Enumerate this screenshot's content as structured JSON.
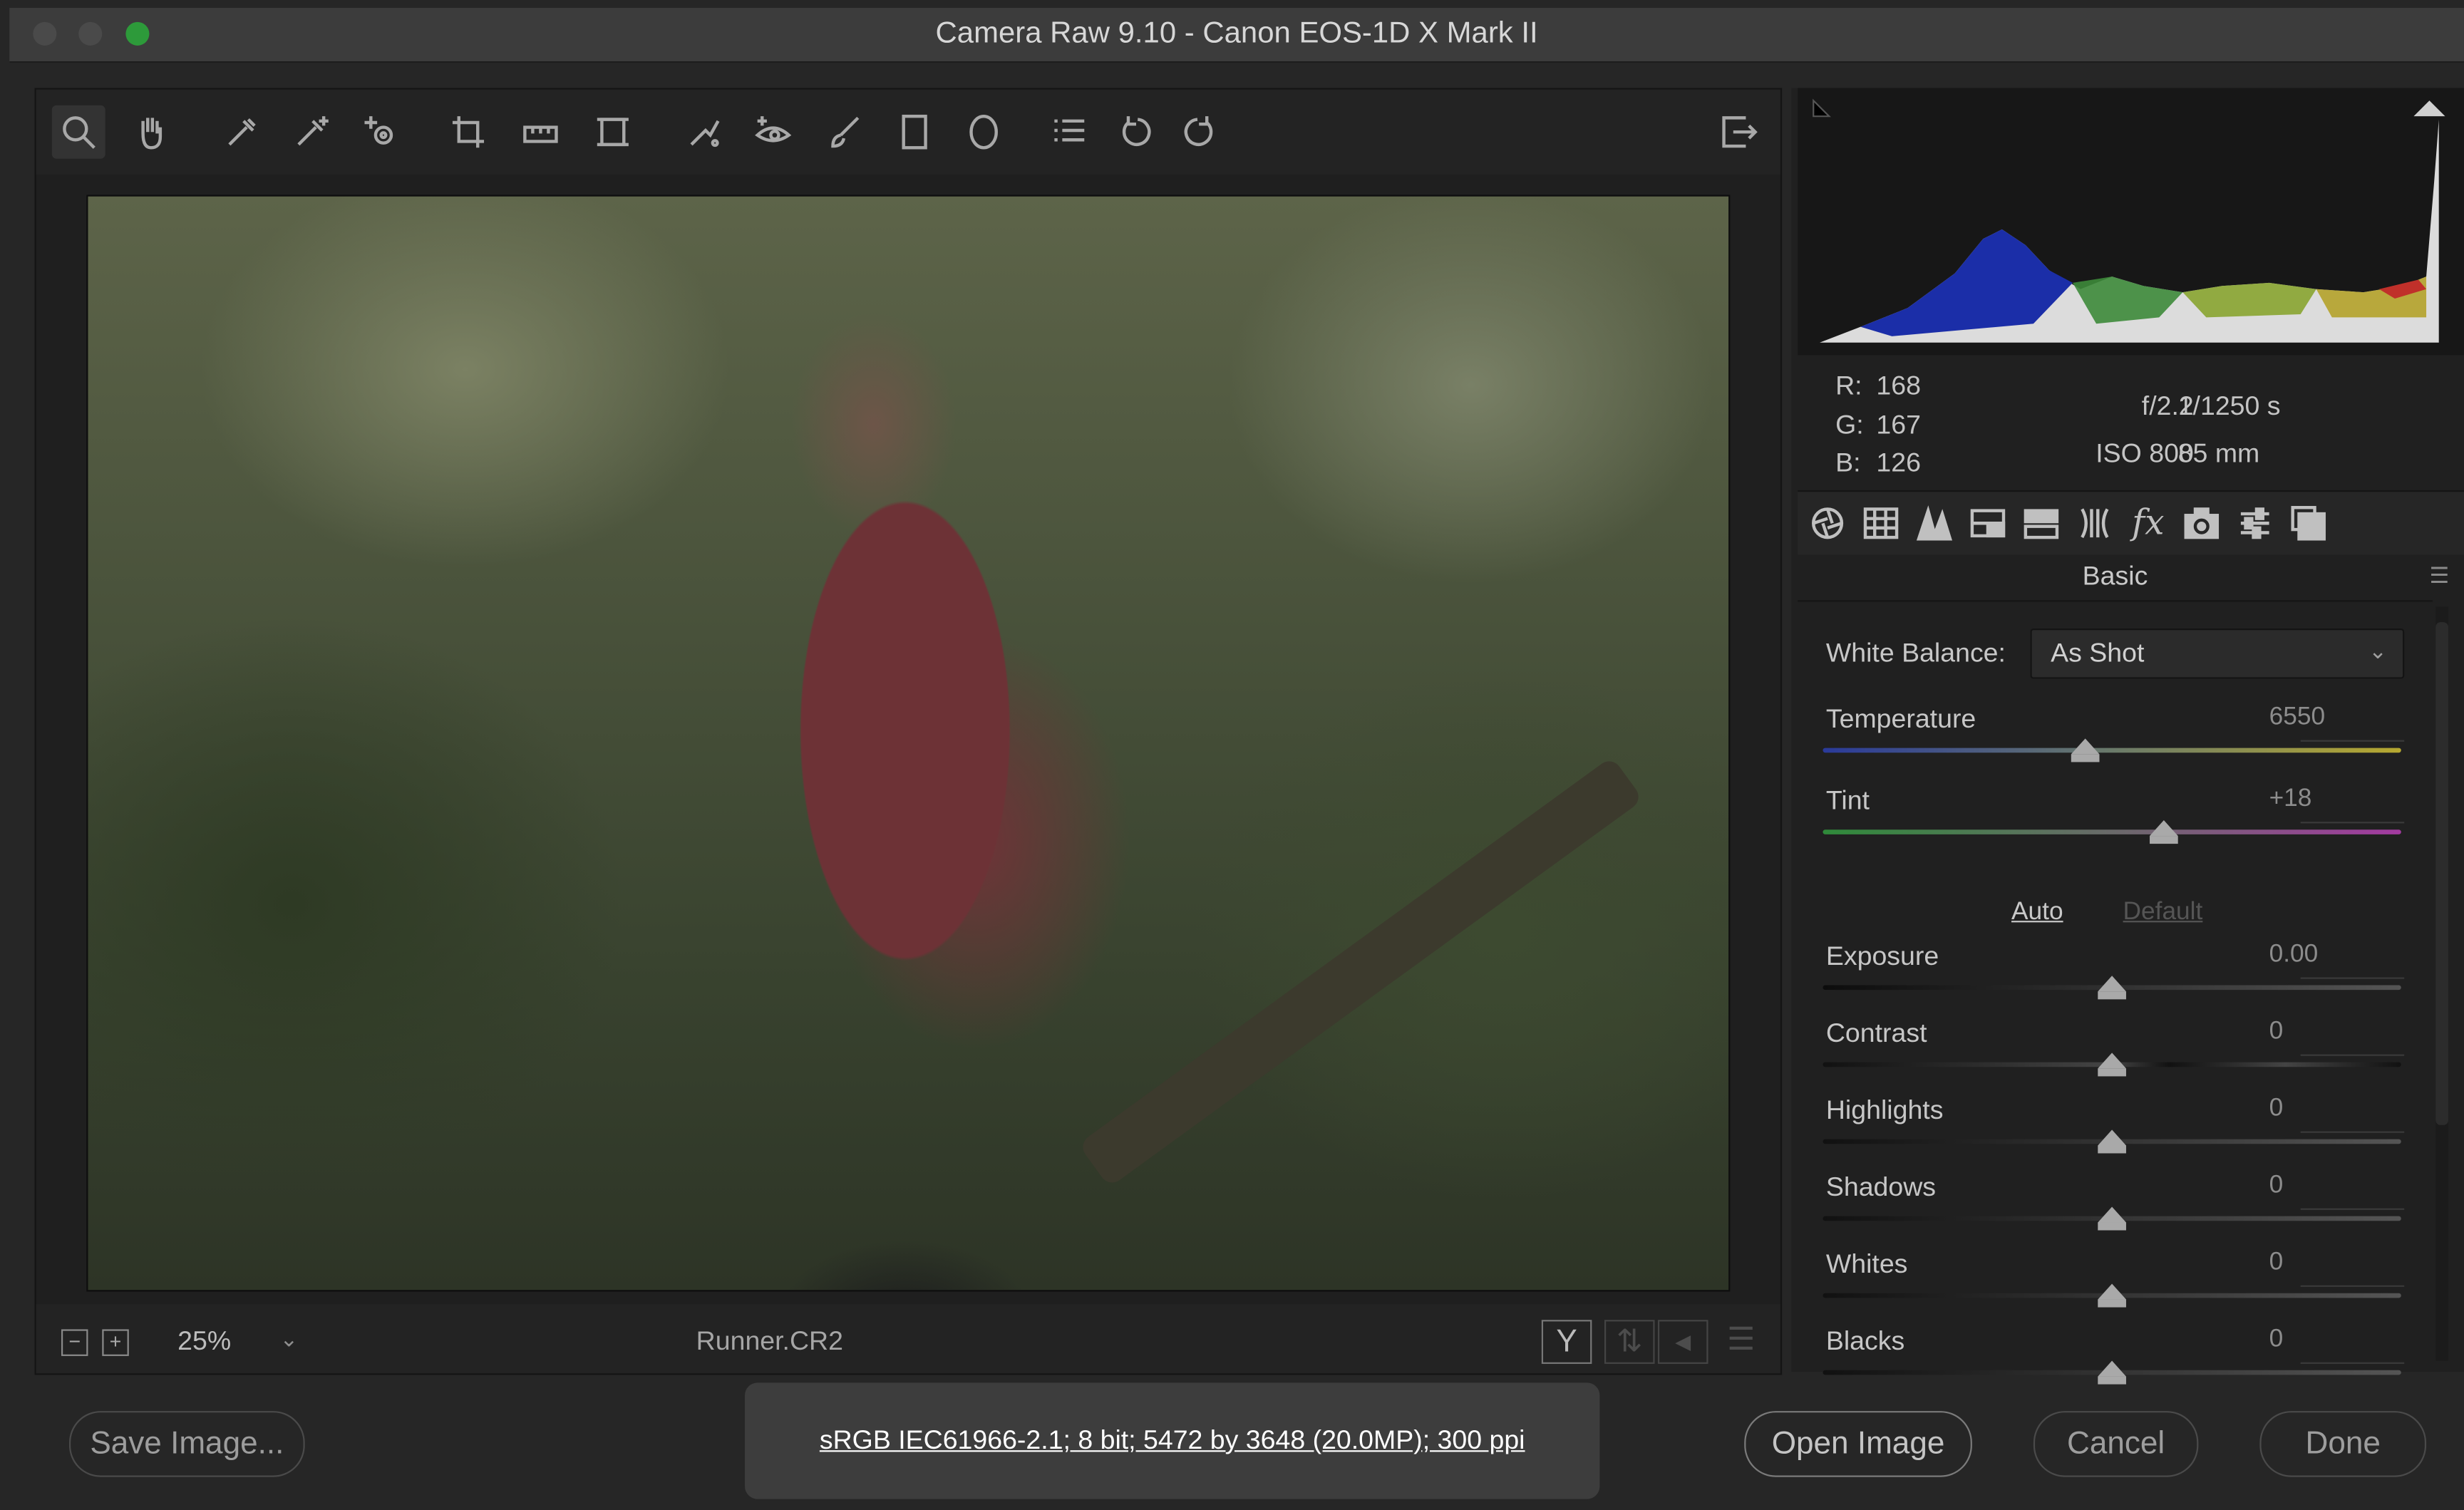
{
  "window": {
    "title": "Camera Raw 9.10  -  Canon EOS-1D X Mark II"
  },
  "toolbar": {
    "tools": [
      "zoom-icon",
      "hand-icon",
      "eyedropper-icon",
      "color-sampler-icon",
      "targeted-adjust-icon",
      "crop-icon",
      "straighten-icon",
      "transform-icon",
      "spot-removal-icon",
      "red-eye-icon",
      "adjustment-brush-icon",
      "graduated-filter-icon",
      "radial-filter-icon",
      "presets-list-icon",
      "rotate-left-icon",
      "rotate-right-icon"
    ],
    "export_icon": "open-preferences-icon"
  },
  "status": {
    "zoom": "25%",
    "filename": "Runner.CR2"
  },
  "readout": {
    "r_label": "R:",
    "r": "168",
    "g_label": "G:",
    "g": "167",
    "b_label": "B:",
    "b": "126",
    "aperture": "f/2.2",
    "shutter": "1/1250 s",
    "iso": "ISO 800",
    "focal": "85 mm"
  },
  "panel": {
    "title": "Basic",
    "white_balance_label": "White Balance:",
    "white_balance_value": "As Shot",
    "auto": "Auto",
    "default": "Default",
    "sliders": [
      {
        "label": "Temperature",
        "value": "6550",
        "level": 0.455
      },
      {
        "label": "Tint",
        "value": "+18",
        "level": 0.59
      },
      {
        "label": "Exposure",
        "value": "0.00",
        "level": 0.5
      },
      {
        "label": "Contrast",
        "value": "0",
        "level": 0.5
      },
      {
        "label": "Highlights",
        "value": "0",
        "level": 0.5
      },
      {
        "label": "Shadows",
        "value": "0",
        "level": 0.5
      },
      {
        "label": "Whites",
        "value": "0",
        "level": 0.5
      },
      {
        "label": "Blacks",
        "value": "0",
        "level": 0.5
      }
    ]
  },
  "footer": {
    "save": "Save Image...",
    "workflow": "sRGB IEC61966-2.1; 8 bit; 5472 by 3648 (20.0MP); 300 ppi",
    "open": "Open Image",
    "cancel": "Cancel",
    "done": "Done"
  }
}
